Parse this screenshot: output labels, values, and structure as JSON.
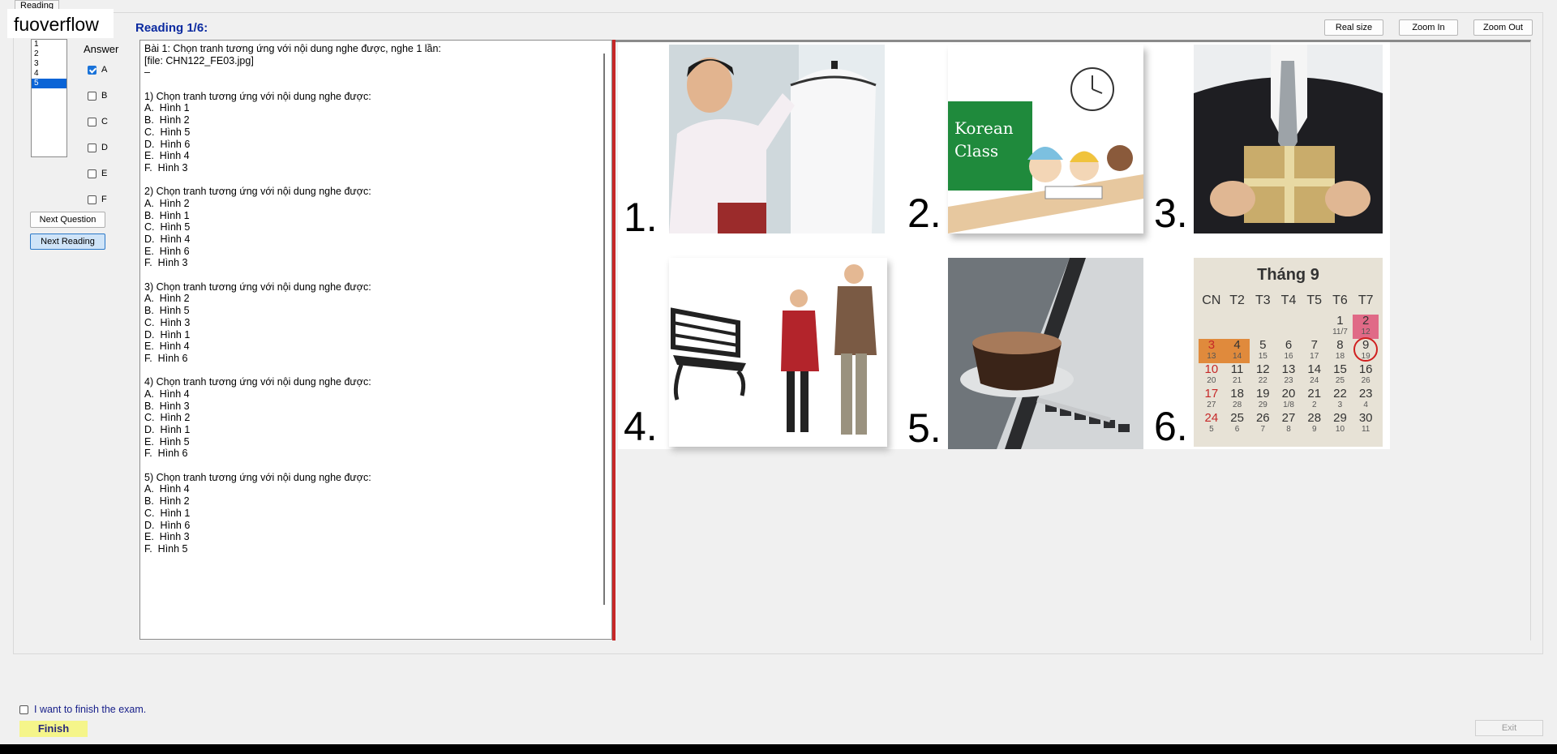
{
  "tab": {
    "label": "Reading"
  },
  "brand": "fuoverflow",
  "reading_title": "Reading 1/6:",
  "toolbar": {
    "real_size": "Real size",
    "zoom_in": "Zoom In",
    "zoom_out": "Zoom Out"
  },
  "question_list": {
    "items": [
      "1",
      "2",
      "3",
      "4",
      "5"
    ],
    "selected": "5"
  },
  "answer": {
    "label": "Answer",
    "options": [
      {
        "label": "A",
        "checked": true
      },
      {
        "label": "B",
        "checked": false
      },
      {
        "label": "C",
        "checked": false
      },
      {
        "label": "D",
        "checked": false
      },
      {
        "label": "E",
        "checked": false
      },
      {
        "label": "F",
        "checked": false
      }
    ]
  },
  "buttons": {
    "next_question": "Next Question",
    "next_reading": "Next Reading"
  },
  "content": {
    "lines": [
      "Bài 1: Chọn tranh tương ứng với nội dung nghe được, nghe 1 lần:",
      "[file: CHN122_FE03.jpg]",
      "–",
      "",
      "1) Chọn tranh tương ứng với nội dung nghe được:",
      "A.  Hình 1",
      "B.  Hình 2",
      "C.  Hình 5",
      "D.  Hình 6",
      "E.  Hình 4",
      "F.  Hình 3",
      "",
      "2) Chọn tranh tương ứng với nội dung nghe được:",
      "A.  Hình 2",
      "B.  Hình 1",
      "C.  Hình 5",
      "D.  Hình 4",
      "E.  Hình 6",
      "F.  Hình 3",
      "",
      "3) Chọn tranh tương ứng với nội dung nghe được:",
      "A.  Hình 2",
      "B.  Hình 5",
      "C.  Hình 3",
      "D.  Hình 1",
      "E.  Hình 4",
      "F.  Hình 6",
      "",
      "4) Chọn tranh tương ứng với nội dung nghe được:",
      "A.  Hình 4",
      "B.  Hình 3",
      "C.  Hình 2",
      "D.  Hình 1",
      "E.  Hình 5",
      "F.  Hình 6",
      "",
      "5) Chọn tranh tương ứng với nội dung nghe được:",
      "A.  Hình 4",
      "B.  Hình 2",
      "C.  Hình 1",
      "D.  Hình 6",
      "E.  Hình 3",
      "F.  Hình 5"
    ]
  },
  "images": {
    "numbers": [
      "1.",
      "2.",
      "3.",
      "4.",
      "5.",
      "6."
    ],
    "korean_class": [
      "Korean",
      "Class"
    ],
    "calendar": {
      "title": "Tháng 9",
      "days": [
        "CN",
        "T2",
        "T3",
        "T4",
        "T5",
        "T6",
        "T7"
      ],
      "weeks": [
        [
          [
            "",
            ""
          ],
          [
            "",
            ""
          ],
          [
            "",
            ""
          ],
          [
            "",
            ""
          ],
          [
            "",
            ""
          ],
          [
            "1",
            "11/7"
          ],
          [
            "2",
            "12"
          ]
        ],
        [
          [
            "3",
            "13"
          ],
          [
            "4",
            "14"
          ],
          [
            "5",
            "15"
          ],
          [
            "6",
            "16"
          ],
          [
            "7",
            "17"
          ],
          [
            "8",
            "18"
          ],
          [
            "9",
            "19"
          ]
        ],
        [
          [
            "10",
            "20"
          ],
          [
            "11",
            "21"
          ],
          [
            "12",
            "22"
          ],
          [
            "13",
            "23"
          ],
          [
            "14",
            "24"
          ],
          [
            "15",
            "25"
          ],
          [
            "16",
            "26"
          ]
        ],
        [
          [
            "17",
            "27"
          ],
          [
            "18",
            "28"
          ],
          [
            "19",
            "29"
          ],
          [
            "20",
            "1/8"
          ],
          [
            "21",
            "2"
          ],
          [
            "22",
            "3"
          ],
          [
            "23",
            "4"
          ]
        ],
        [
          [
            "24",
            "5"
          ],
          [
            "25",
            "6"
          ],
          [
            "26",
            "7"
          ],
          [
            "27",
            "8"
          ],
          [
            "28",
            "9"
          ],
          [
            "29",
            "10"
          ],
          [
            "30",
            "11"
          ]
        ]
      ]
    }
  },
  "finish": {
    "checkbox_label": "I want to finish the exam.",
    "button": "Finish",
    "exit": "Exit"
  },
  "colors": {
    "title_blue": "#0b2aa0",
    "divider_red": "#c62828",
    "finish_yellow": "#f5f58a",
    "select_blue": "#0a64d6"
  }
}
